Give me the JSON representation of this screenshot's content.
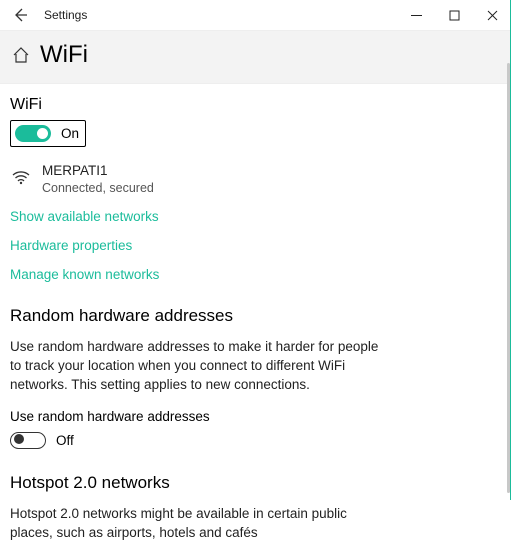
{
  "titlebar": {
    "app_name": "Settings"
  },
  "header": {
    "title": "WiFi"
  },
  "wifi": {
    "section_label": "WiFi",
    "toggle_state": "On",
    "network_name": "MERPATI1",
    "network_status": "Connected, secured"
  },
  "links": {
    "show_networks": "Show available networks",
    "hardware_props": "Hardware properties",
    "manage_known": "Manage known networks"
  },
  "random_hw": {
    "heading": "Random hardware addresses",
    "description": "Use random hardware addresses to make it harder for people to track your location when you connect to different WiFi networks. This setting applies to new connections.",
    "toggle_label": "Use random hardware addresses",
    "toggle_state": "Off"
  },
  "hotspot": {
    "heading": "Hotspot 2.0 networks",
    "description": "Hotspot 2.0 networks might be available in certain public places, such as airports, hotels and cafés"
  }
}
